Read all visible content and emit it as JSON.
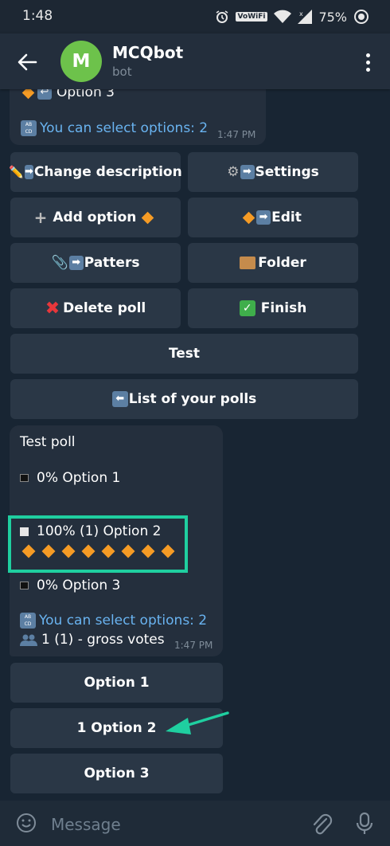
{
  "status": {
    "time": "1:48",
    "network": "VoWiFi",
    "battery": "75%"
  },
  "header": {
    "title": "MCQbot",
    "subtitle": "bot",
    "avatar_letter": "M"
  },
  "message_top": {
    "option_line": "Option 3",
    "select_hint": "You can select options: 2",
    "time": "1:47 PM"
  },
  "keyboard_top": {
    "change_description": "Change description",
    "settings": "Settings",
    "add_option": "Add option",
    "edit": "Edit",
    "patters": "Patters",
    "folder": "Folder",
    "delete_poll": "Delete poll",
    "finish": "Finish",
    "test": "Test",
    "list_polls": "List of your polls"
  },
  "poll": {
    "title": "Test poll",
    "option1": "0% Option 1",
    "option2": "100% (1) Option 2",
    "option3": "0% Option 3",
    "select_hint": "You can select options: 2",
    "votes": "1 (1) - gross votes",
    "time": "1:47 PM"
  },
  "keyboard_bottom": {
    "option1": "Option 1",
    "option2": "1 Option 2",
    "option3": "Option 3"
  },
  "composer": {
    "placeholder": "Message"
  },
  "colors": {
    "highlight_box": "#1fcfa0",
    "arrow": "#1fcfa0",
    "link": "#69b3f0",
    "avatar": "#6dc24b"
  }
}
